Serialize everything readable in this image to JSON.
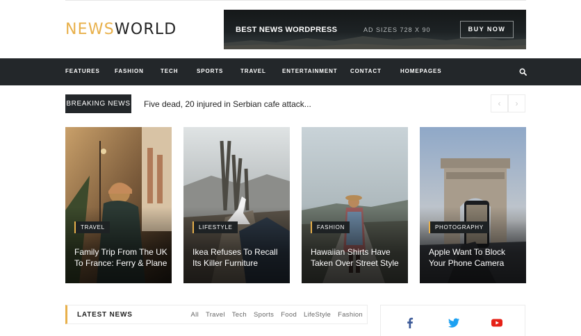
{
  "logo": {
    "part1": "NEWS",
    "part2": "WORLD"
  },
  "ad": {
    "title": "BEST NEWS WORDPRESS",
    "sizes": "AD SIZES 728 X 90",
    "button": "BUY NOW"
  },
  "nav": {
    "items": [
      "FEATURES",
      "FASHION",
      "TECH",
      "SPORTS",
      "TRAVEL",
      "ENTERTAINMENT",
      "CONTACT",
      "HOMEPAGES"
    ],
    "search_icon": "search-icon"
  },
  "breaking": {
    "label": "BREAKING NEWS",
    "headline": "Five dead, 20 injured in Serbian cafe attack...",
    "prev_icon": "chevron-left-icon",
    "next_icon": "chevron-right-icon"
  },
  "cards": [
    {
      "category": "TRAVEL",
      "title": "Family Trip From The UK To France: Ferry & Plane"
    },
    {
      "category": "LIFESTYLE",
      "title": "Ikea Refuses To Recall Its Killer Furniture"
    },
    {
      "category": "FASHION",
      "title": "Hawaiian Shirts Have Taken Over Street Style"
    },
    {
      "category": "PHOTOGRAPHY",
      "title": "Apple Want To Block Your Phone Camera"
    }
  ],
  "latest": {
    "title": "LATEST NEWS",
    "filters": [
      "All",
      "Travel",
      "Tech",
      "Sports",
      "Food",
      "LifeStyle",
      "Fashion"
    ]
  },
  "social": {
    "icons": [
      "facebook-icon",
      "twitter-icon",
      "youtube-icon"
    ],
    "colors": {
      "facebook": "#3b5998",
      "twitter": "#1da1f2",
      "youtube": "#e62117",
      "accent": "#e8b04a",
      "dark": "#23272a"
    }
  }
}
